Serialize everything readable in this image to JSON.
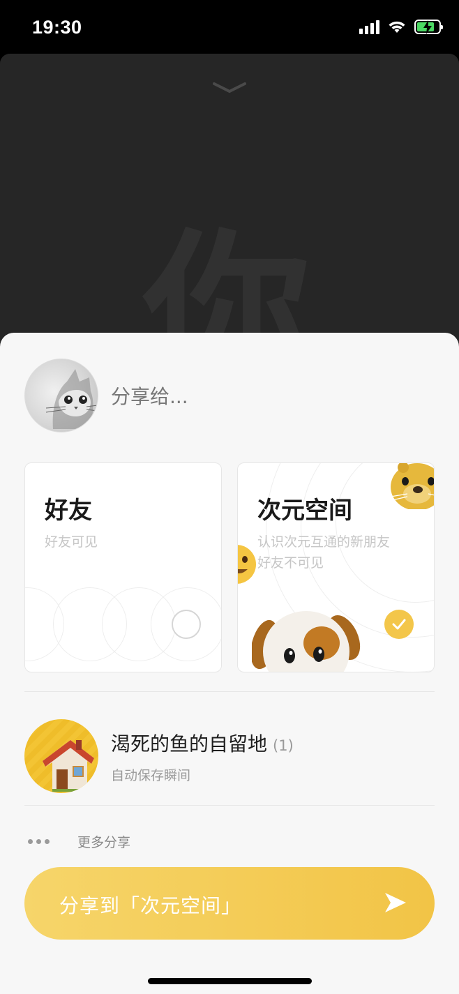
{
  "status_bar": {
    "time": "19:30"
  },
  "background": {
    "glyph": "你"
  },
  "share_sheet": {
    "share_to_label": "分享给...",
    "options": [
      {
        "title": "好友",
        "subtitle": "好友可见",
        "selected": false
      },
      {
        "title": "次元空间",
        "subtitle_lines": [
          "认识次元互通的新朋友",
          "好友不可见"
        ],
        "selected": true
      }
    ],
    "album": {
      "name": "渴死的鱼的自留地",
      "count": "(1)",
      "subtitle": "自动保存瞬间"
    },
    "more_share_label": "更多分享",
    "share_button_label": "分享到「次元空间」"
  },
  "colors": {
    "accent": "#f3c64a",
    "sheet_bg": "#f7f7f7",
    "dark_bg": "#262626"
  },
  "icons": [
    "chevron-down-icon",
    "signal-icon",
    "wifi-icon",
    "battery-icon",
    "checkmark-icon",
    "more-dots-icon",
    "send-icon"
  ]
}
